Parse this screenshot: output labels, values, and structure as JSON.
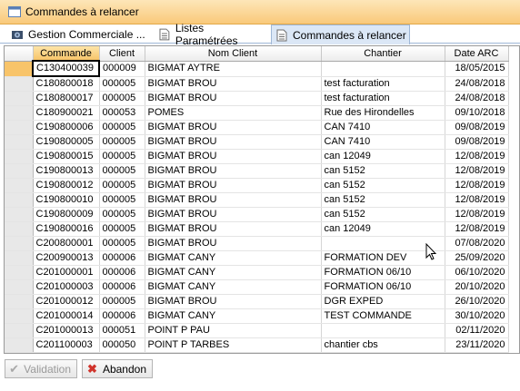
{
  "window": {
    "title": "Commandes à relancer"
  },
  "tabs": [
    {
      "label": "Gestion Commerciale ...",
      "icon": "gear-app-icon"
    },
    {
      "label": "Listes Paramétrées",
      "icon": "document-icon"
    },
    {
      "label": "Commandes à relancer",
      "icon": "document-icon",
      "active": true
    }
  ],
  "grid": {
    "columns": [
      "Commande",
      "Client",
      "Nom Client",
      "Chantier",
      "Date ARC"
    ],
    "rows": [
      [
        "C130400039",
        "000009",
        "BIGMAT AYTRE",
        "",
        "18/05/2015"
      ],
      [
        "C180800018",
        "000005",
        "BIGMAT BROU",
        "test facturation",
        "24/08/2018"
      ],
      [
        "C180800017",
        "000005",
        "BIGMAT BROU",
        "test facturation",
        "24/08/2018"
      ],
      [
        "C180900021",
        "000053",
        "POMES",
        "Rue des Hirondelles",
        "09/10/2018"
      ],
      [
        "C190800006",
        "000005",
        "BIGMAT BROU",
        "CAN 7410",
        "09/08/2019"
      ],
      [
        "C190800005",
        "000005",
        "BIGMAT BROU",
        "CAN 7410",
        "09/08/2019"
      ],
      [
        "C190800015",
        "000005",
        "BIGMAT BROU",
        "can 12049",
        "12/08/2019"
      ],
      [
        "C190800013",
        "000005",
        "BIGMAT BROU",
        "can 5152",
        "12/08/2019"
      ],
      [
        "C190800012",
        "000005",
        "BIGMAT BROU",
        "can 5152",
        "12/08/2019"
      ],
      [
        "C190800010",
        "000005",
        "BIGMAT BROU",
        "can 5152",
        "12/08/2019"
      ],
      [
        "C190800009",
        "000005",
        "BIGMAT BROU",
        "can 5152",
        "12/08/2019"
      ],
      [
        "C190800016",
        "000005",
        "BIGMAT BROU",
        "can 12049",
        "12/08/2019"
      ],
      [
        "C200800001",
        "000005",
        "BIGMAT BROU",
        "",
        "07/08/2020"
      ],
      [
        "C200900013",
        "000006",
        "BIGMAT CANY",
        "FORMATION DEV",
        "25/09/2020"
      ],
      [
        "C201000001",
        "000006",
        "BIGMAT CANY",
        "FORMATION 06/10",
        "06/10/2020"
      ],
      [
        "C201000003",
        "000006",
        "BIGMAT CANY",
        "FORMATION 06/10",
        "20/10/2020"
      ],
      [
        "C201000012",
        "000005",
        "BIGMAT BROU",
        "DGR EXPED",
        "26/10/2020"
      ],
      [
        "C201000014",
        "000006",
        "BIGMAT CANY",
        "TEST COMMANDE",
        "30/10/2020"
      ],
      [
        "C201000013",
        "000051",
        "POINT P PAU",
        "",
        "02/11/2020"
      ],
      [
        "C201100003",
        "000050",
        "POINT P TARBES",
        "chantier cbs",
        "23/11/2020"
      ]
    ]
  },
  "buttons": {
    "validate": {
      "label": "Validation",
      "icon": "checkmark-icon",
      "enabled": false
    },
    "cancel": {
      "label": "Abandon",
      "icon": "close-icon",
      "enabled": true
    }
  },
  "colors": {
    "title_bar": "#f9c97a",
    "active_tab": "#dbe7f6",
    "selected_indicator": "#f8c46a",
    "cancel_icon": "#d0342c"
  }
}
